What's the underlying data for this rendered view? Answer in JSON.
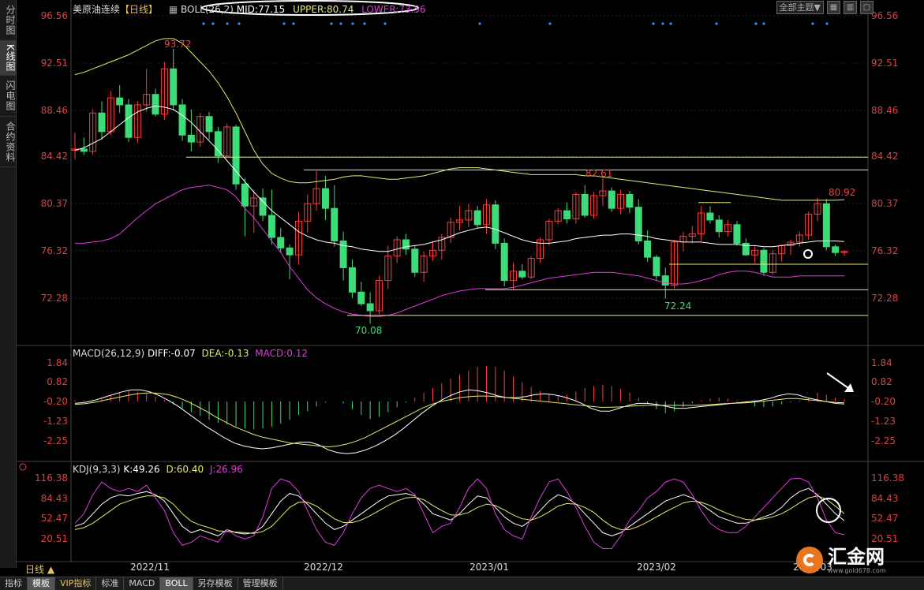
{
  "side_tabs": [
    {
      "label": "分时图"
    },
    {
      "label": "K线图"
    },
    {
      "label": "闪电图"
    },
    {
      "label": "合约资料"
    }
  ],
  "header": {
    "symbol": "美原油连续",
    "period_tag": "【日线】",
    "indicator": "BOLL(26,2)",
    "mid": "MID:77.15",
    "upper": "UPPER:80.74",
    "lower": "LOWER:73.56"
  },
  "toolbar": {
    "theme_select": "全部主题",
    "theme_arrow": "▼"
  },
  "price_axis": {
    "labels": [
      "96.56",
      "92.51",
      "88.46",
      "84.42",
      "80.37",
      "76.32",
      "72.28"
    ]
  },
  "annotations": {
    "high": "93.72",
    "low": "70.08",
    "mid_high": "82.61",
    "right_high": "80.92",
    "mid_low": "72.24"
  },
  "macd": {
    "title": "MACD(26,12,9)",
    "diff": "DIFF:-0.07",
    "dea": "DEA:-0.13",
    "macd": "MACD:0.12",
    "axis": [
      "1.84",
      "0.82",
      "-0.20",
      "-1.23",
      "-2.25"
    ]
  },
  "kdj": {
    "title": "KDJ(9,3,3)",
    "k": "K:49.26",
    "d": "D:60.40",
    "j": "J:26.96",
    "axis": [
      "116.38",
      "84.43",
      "52.47",
      "20.51"
    ]
  },
  "dates": [
    "2022/11",
    "2022/12",
    "2023/01",
    "2023/02",
    "2023/03"
  ],
  "period_button": "日线 ▲",
  "bottom_tabs": [
    {
      "label": "指标"
    },
    {
      "label": "模板"
    },
    {
      "label": "VIP指标"
    },
    {
      "label": "标准"
    },
    {
      "label": "MACD"
    },
    {
      "label": "BOLL"
    },
    {
      "label": "另存模板"
    },
    {
      "label": "管理模板"
    }
  ],
  "logo": {
    "name": "汇金网",
    "url": "www.gold678.com"
  },
  "colors": {
    "up": "#ff3c3c",
    "down": "#3cdc78",
    "mid": "#ffffff",
    "upper": "#e8e86e",
    "lower": "#dc3cdc",
    "macd_diff": "#ffffff",
    "macd_dea": "#e8e86e",
    "kdj_j": "#dc3cdc"
  }
}
